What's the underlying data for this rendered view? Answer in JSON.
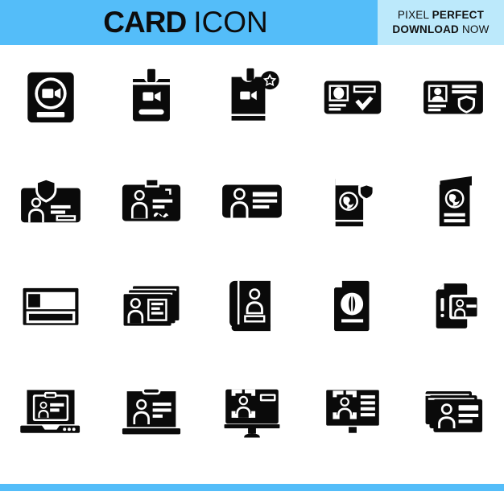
{
  "header": {
    "title_bold": "CARD",
    "title_light": "ICON",
    "badge_line1_light": "PIXEL",
    "badge_line1_bold": "PERFECT",
    "badge_line2_bold": "DOWNLOAD",
    "badge_line2_light": "NOW",
    "bg_color": "#54bdf9",
    "badge_bg_color": "#bce9fb",
    "text_color": "#0d0d0d"
  },
  "footer": {
    "bar_color": "#54bdf9"
  },
  "grid": {
    "columns": 5,
    "rows": 4,
    "icon_color": "#0a0a0a",
    "icons": [
      {
        "name": "video-card-circle-icon",
        "label": "Card with video camera in circle"
      },
      {
        "name": "video-badge-lanyard-icon",
        "label": "Badge with video camera and clip"
      },
      {
        "name": "video-badge-star-icon",
        "label": "Badge with video camera and star"
      },
      {
        "name": "id-card-check-icon",
        "label": "ID card with checkmark"
      },
      {
        "name": "id-card-shield-icon",
        "label": "ID card with shield"
      },
      {
        "name": "id-card-shield-top-icon",
        "label": "ID card with shield above photo"
      },
      {
        "name": "id-badge-clip-signature-icon",
        "label": "ID badge with clip and signature"
      },
      {
        "name": "id-card-person-lines-icon",
        "label": "ID card with person and text lines"
      },
      {
        "name": "passport-shield-icon",
        "label": "Passport with shield"
      },
      {
        "name": "passport-open-globe-icon",
        "label": "Open passport with globe"
      },
      {
        "name": "card-photo-lines-icon",
        "label": "Card with photo and text lines"
      },
      {
        "name": "id-cards-stack-icon",
        "label": "Stack of ID cards"
      },
      {
        "name": "id-book-person-icon",
        "label": "Book with person photo"
      },
      {
        "name": "document-globe-icon",
        "label": "Document with globe"
      },
      {
        "name": "document-alert-id-card-icon",
        "label": "Document with alert and ID card"
      },
      {
        "name": "laptop-id-card-icon",
        "label": "Laptop showing ID card"
      },
      {
        "name": "monitor-id-clip-icon",
        "label": "Monitor with ID and clip"
      },
      {
        "name": "monitor-face-scan-icon",
        "label": "Monitor with face scan frame"
      },
      {
        "name": "monitor-face-scan-lines-icon",
        "label": "Monitor with face scan and lines"
      },
      {
        "name": "id-cards-stack-person-icon",
        "label": "Stacked ID cards with person"
      }
    ]
  }
}
